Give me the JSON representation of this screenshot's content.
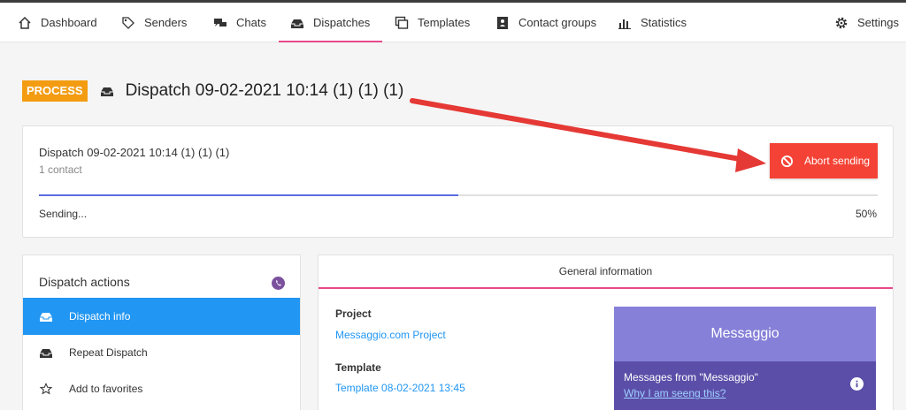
{
  "nav": {
    "dashboard": "Dashboard",
    "senders": "Senders",
    "chats": "Chats",
    "dispatches": "Dispatches",
    "templates": "Templates",
    "contact_groups": "Contact groups",
    "statistics": "Statistics",
    "settings": "Settings",
    "active_item": "dispatches"
  },
  "page": {
    "status_badge": "PROCESS",
    "title": "Dispatch 09-02-2021 10:14 (1) (1) (1)"
  },
  "progress_card": {
    "name": "Dispatch 09-02-2021 10:14 (1) (1) (1)",
    "contacts": "1 contact",
    "abort_label": "Abort sending",
    "status": "Sending...",
    "percent_label": "50%",
    "progress_fraction": 0.5
  },
  "actions": {
    "title": "Dispatch actions",
    "items": [
      {
        "label": "Dispatch info",
        "icon": "inbox-icon",
        "active": true
      },
      {
        "label": "Repeat Dispatch",
        "icon": "inbox-icon",
        "active": false
      },
      {
        "label": "Add to favorites",
        "icon": "star-icon",
        "active": false
      }
    ]
  },
  "general_info": {
    "header": "General information",
    "project_label": "Project",
    "project_value": "Messaggio.com Project",
    "template_label": "Template",
    "template_value": "Template 08-02-2021 13:45",
    "preview": {
      "sender": "Messaggio",
      "message": "Messages from \"Messaggio\"",
      "link": "Why I am seeng this?"
    }
  },
  "colors": {
    "accent_pink": "#e8488a",
    "badge_orange": "#f39c12",
    "abort_red": "#f44336",
    "active_blue": "#2196f3",
    "progress_blue": "#5b6ee1",
    "viber_purple": "#7b519d"
  }
}
